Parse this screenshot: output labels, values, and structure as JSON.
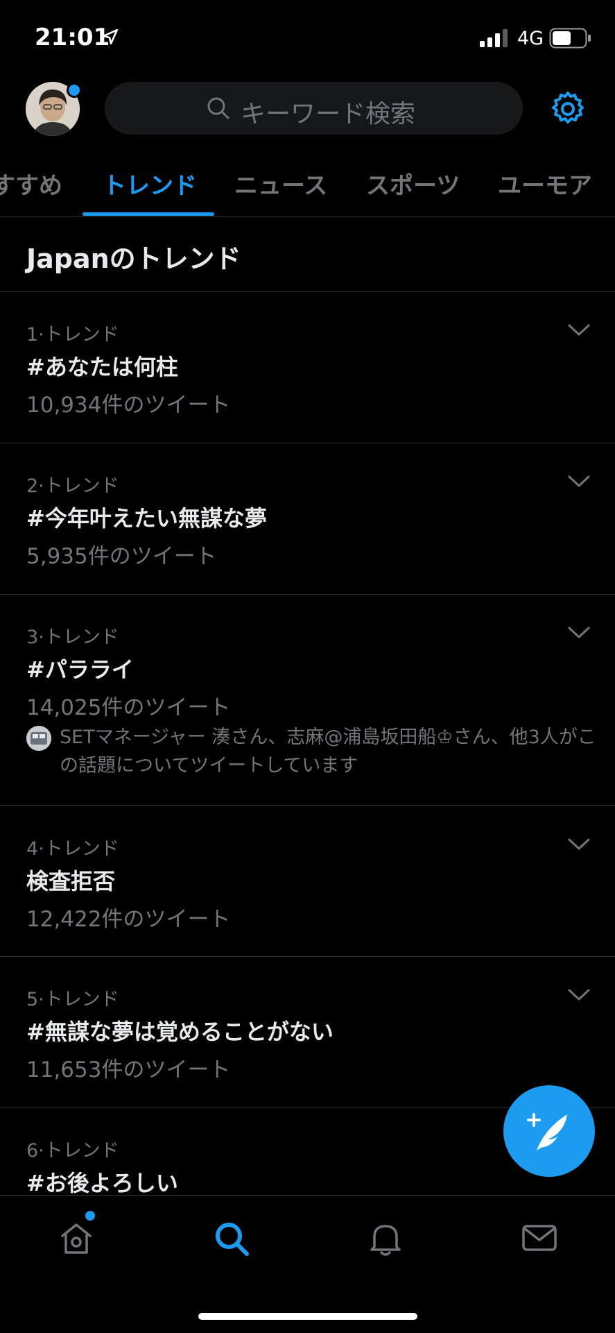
{
  "status_bar": {
    "time": "21:01",
    "network": "4G"
  },
  "search": {
    "placeholder": "キーワード検索"
  },
  "tabs": [
    {
      "label": "すすめ"
    },
    {
      "label": "トレンド",
      "active": true
    },
    {
      "label": "ニュース"
    },
    {
      "label": "スポーツ"
    },
    {
      "label": "ユーモア"
    }
  ],
  "section_title": "Japanのトレンド",
  "trends": [
    {
      "meta": "1·トレンド",
      "name": "#あなたは何柱",
      "count": "10,934件のツイート"
    },
    {
      "meta": "2·トレンド",
      "name": "#今年叶えたい無謀な夢",
      "count": "5,935件のツイート"
    },
    {
      "meta": "3·トレンド",
      "name": "#パラライ",
      "count": "14,025件のツイート",
      "context": "SETマネージャー 湊さん、志麻@浦島坂田船♔さん、他3人がこの話題についてツイートしています"
    },
    {
      "meta": "4·トレンド",
      "name": "検査拒否",
      "count": "12,422件のツイート"
    },
    {
      "meta": "5·トレンド",
      "name": "#無謀な夢は覚めることがない",
      "count": "11,653件のツイート"
    },
    {
      "meta": "6·トレンド",
      "name": "#お後よろしい"
    }
  ],
  "colors": {
    "accent": "#1d9bf0",
    "background": "#000000",
    "muted": "#71767b",
    "text": "#e7e9ea"
  },
  "icons": {
    "location": "location-arrow-icon",
    "settings": "gear-icon",
    "compose": "compose-tweet-icon",
    "home": "home-icon",
    "explore": "search-icon",
    "notifications": "bell-icon",
    "messages": "mail-icon"
  }
}
